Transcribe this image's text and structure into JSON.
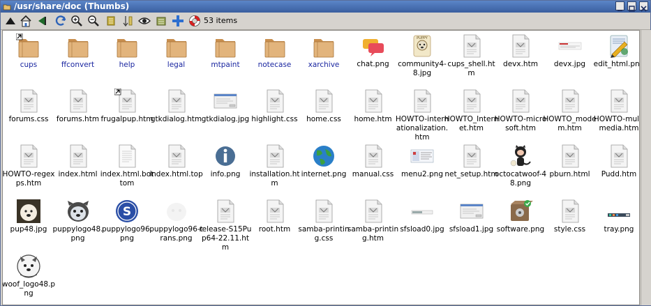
{
  "window": {
    "title": "/usr/share/doc (Thumbs)"
  },
  "toolbar": {
    "items_count": "53 items",
    "icons": [
      "up-arrow-icon",
      "home-icon",
      "back-icon",
      "refresh-icon",
      "zoom-in-icon",
      "zoom-out-icon",
      "select-icon",
      "sort-icon",
      "eye-icon",
      "list-icon",
      "plus-icon",
      "lifebuoy-icon"
    ]
  },
  "colors": {
    "folder": "#d9a86a",
    "dir_label": "#1a26a0",
    "titlebar": "#4a73b8"
  },
  "files": [
    {
      "label": "cups",
      "type": "folder",
      "link": true
    },
    {
      "label": "ffconvert",
      "type": "folder"
    },
    {
      "label": "help",
      "type": "folder"
    },
    {
      "label": "legal",
      "type": "folder"
    },
    {
      "label": "mtpaint",
      "type": "folder"
    },
    {
      "label": "notecase",
      "type": "folder"
    },
    {
      "label": "xarchive",
      "type": "folder"
    },
    {
      "label": "chat.png",
      "type": "chat"
    },
    {
      "label": "community4-8.jpg",
      "type": "dog-sign"
    },
    {
      "label": "cups_shell.htm",
      "type": "doc"
    },
    {
      "label": "devx.htm",
      "type": "doc"
    },
    {
      "label": "devx.jpg",
      "type": "thumb-wide"
    },
    {
      "label": "edit_html.png",
      "type": "edit"
    },
    {
      "label": "forums.css",
      "type": "doc"
    },
    {
      "label": "forums.htm",
      "type": "doc"
    },
    {
      "label": "frugalpup.htm",
      "type": "doc",
      "link": true
    },
    {
      "label": "gtkdialog.htm",
      "type": "doc"
    },
    {
      "label": "gtkdialog.jpg",
      "type": "thumb-dialog"
    },
    {
      "label": "highlight.css",
      "type": "doc"
    },
    {
      "label": "home.css",
      "type": "doc"
    },
    {
      "label": "home.htm",
      "type": "doc"
    },
    {
      "label": "HOWTO-internationalization.htm",
      "type": "doc"
    },
    {
      "label": "HOWTO_Internet.htm",
      "type": "doc"
    },
    {
      "label": "HOWTO-microsoft.htm",
      "type": "doc"
    },
    {
      "label": "HOWTO_modem.htm",
      "type": "doc"
    },
    {
      "label": "HOWTO-multimedia.htm",
      "type": "doc"
    },
    {
      "label": "HOWTO-regexps.htm",
      "type": "doc"
    },
    {
      "label": "index.html",
      "type": "doc"
    },
    {
      "label": "index.html.bottom",
      "type": "text"
    },
    {
      "label": "index.html.top",
      "type": "doc"
    },
    {
      "label": "info.png",
      "type": "info"
    },
    {
      "label": "installation.htm",
      "type": "doc"
    },
    {
      "label": "internet.png",
      "type": "globe"
    },
    {
      "label": "manual.css",
      "type": "doc"
    },
    {
      "label": "menu2.png",
      "type": "thumb-menu"
    },
    {
      "label": "net_setup.htm",
      "type": "doc"
    },
    {
      "label": "octocatwoof-48.png",
      "type": "octocat"
    },
    {
      "label": "pburn.html",
      "type": "doc"
    },
    {
      "label": "Pudd.htm",
      "type": "doc"
    },
    {
      "label": "pup48.jpg",
      "type": "pup"
    },
    {
      "label": "puppylogo48.png",
      "type": "puppylogo"
    },
    {
      "label": "puppylogo96.png",
      "type": "s-logo"
    },
    {
      "label": "puppylogo96-trans.png",
      "type": "ghost"
    },
    {
      "label": "release-S15Pup64-22.11.htm",
      "type": "doc"
    },
    {
      "label": "root.htm",
      "type": "doc"
    },
    {
      "label": "samba-printing.css",
      "type": "doc"
    },
    {
      "label": "samba-printing.htm",
      "type": "doc"
    },
    {
      "label": "sfsload0.jpg",
      "type": "thumb-bar"
    },
    {
      "label": "sfsload1.jpg",
      "type": "thumb-dialog"
    },
    {
      "label": "software.png",
      "type": "software"
    },
    {
      "label": "style.css",
      "type": "doc"
    },
    {
      "label": "tray.png",
      "type": "tray"
    },
    {
      "label": "woof_logo48.png",
      "type": "woof"
    }
  ]
}
